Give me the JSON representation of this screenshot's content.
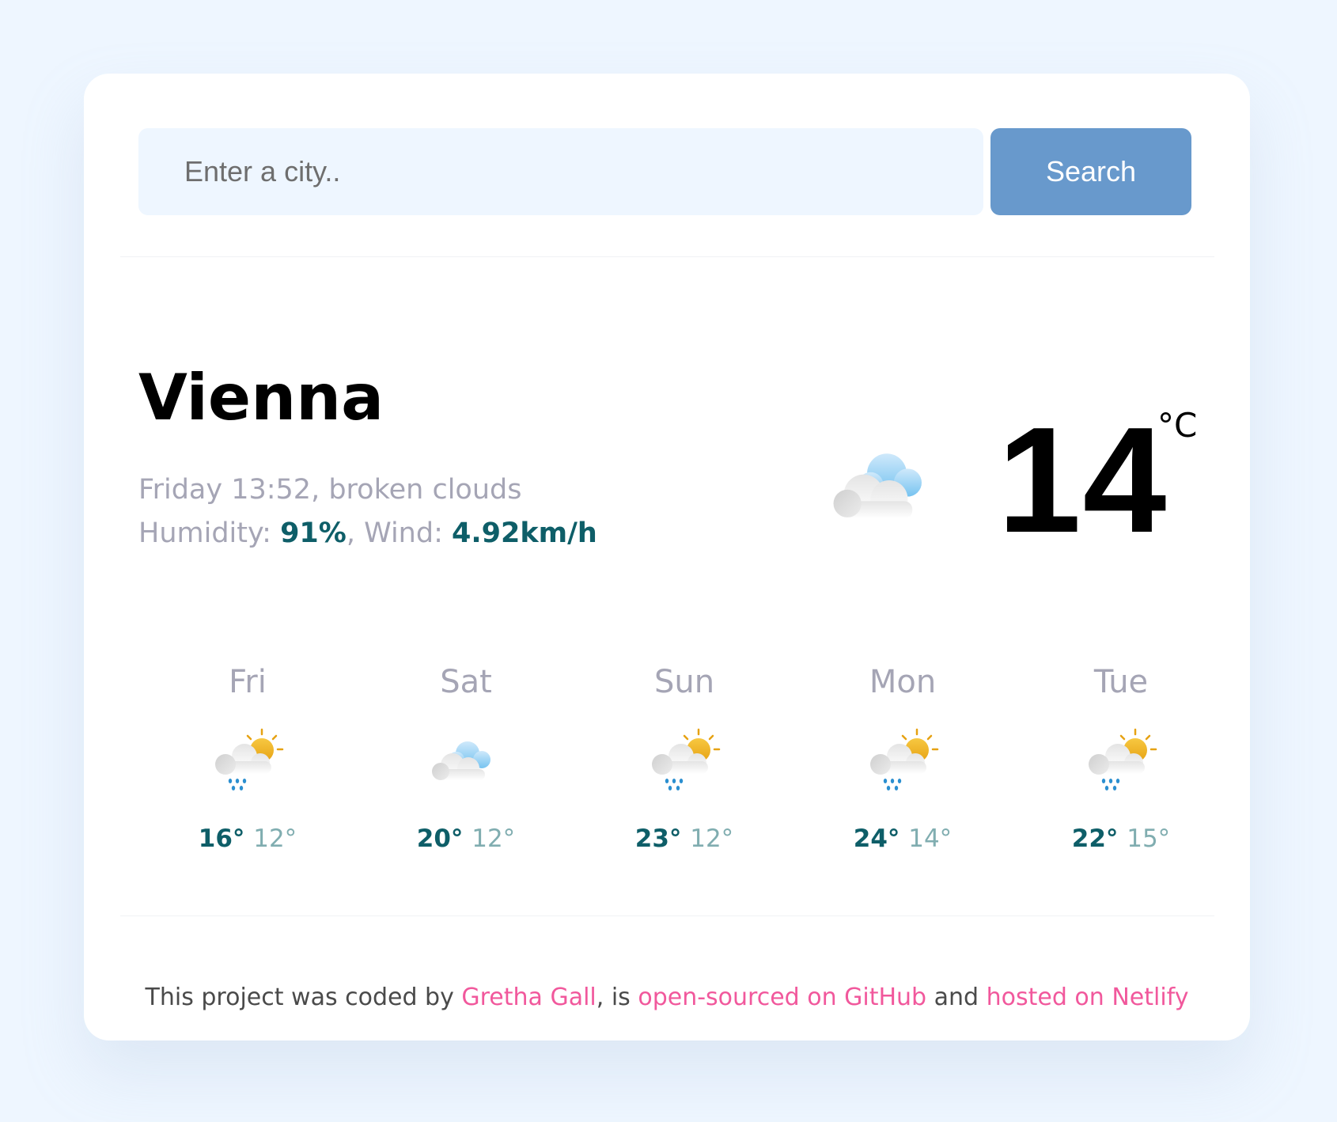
{
  "search": {
    "placeholder": "Enter a city..",
    "button_label": "Search"
  },
  "current": {
    "city": "Vienna",
    "datetime": "Friday 13:52",
    "description": "broken clouds",
    "humidity_label": "Humidity: ",
    "humidity_value": "91%",
    "wind_label": "Wind: ",
    "wind_value": "4.92km/h",
    "temperature": "14",
    "unit": "°C",
    "icon": "broken-clouds-icon"
  },
  "forecast": [
    {
      "day": "Fri",
      "max": "16°",
      "min": "12°",
      "icon": "sun-cloud-rain-icon"
    },
    {
      "day": "Sat",
      "max": "20°",
      "min": "12°",
      "icon": "broken-clouds-icon"
    },
    {
      "day": "Sun",
      "max": "23°",
      "min": "12°",
      "icon": "sun-cloud-rain-icon"
    },
    {
      "day": "Mon",
      "max": "24°",
      "min": "14°",
      "icon": "sun-cloud-rain-icon"
    },
    {
      "day": "Tue",
      "max": "22°",
      "min": "15°",
      "icon": "sun-cloud-rain-icon"
    }
  ],
  "footer": {
    "prefix": "This project was coded by ",
    "author_link": "Gretha Gall",
    "middle": ", is ",
    "github_link": "open-sourced on GitHub",
    "and": " and ",
    "netlify_link": "hosted on Netlify"
  },
  "colors": {
    "page_background": "#eef6ff",
    "accent_button": "#6899cc",
    "highlight_teal": "#0e5e68",
    "link_pink": "#f1589c",
    "muted_text": "#a5a5b5"
  }
}
